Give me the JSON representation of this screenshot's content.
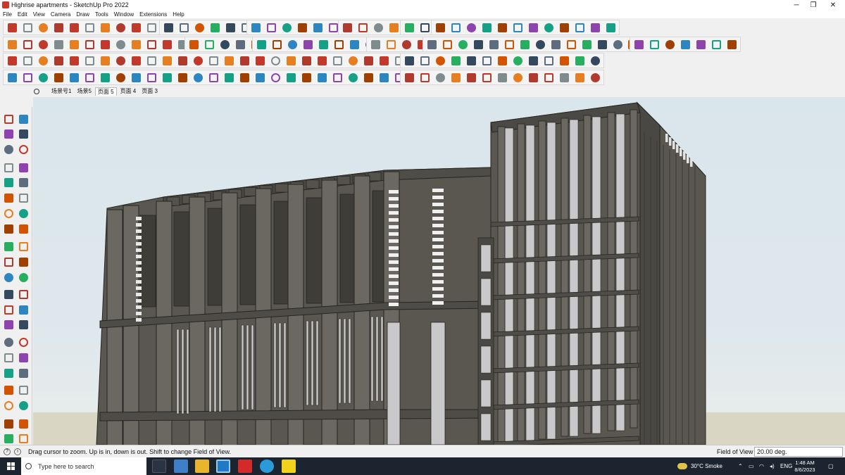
{
  "window": {
    "title": "Highrise apartments - SketchUp Pro 2022",
    "controls": {
      "minimize": "─",
      "restore": "❐",
      "close": "✕"
    }
  },
  "menu": [
    "File",
    "Edit",
    "View",
    "Camera",
    "Draw",
    "Tools",
    "Window",
    "Extensions",
    "Help"
  ],
  "scenes": {
    "tabs": [
      "场景号1",
      "场景5",
      "页面 5",
      "页面 4",
      "页面 3"
    ],
    "active_index": 2
  },
  "status": {
    "message": "Drag cursor to zoom.  Up is in, down is out. Shift to change Field of View.",
    "vcb_label": "Field of View",
    "vcb_value": "20.00 deg."
  },
  "taskbar": {
    "search_placeholder": "Type here to search",
    "weather": "30°C  Smoke",
    "language": "ENG",
    "time": "1:48 AM",
    "date": "8/6/2023"
  },
  "colors": {
    "toolbar_bg": "#f0f0f0",
    "building_facade": "#5a5751",
    "building_fin": "#6b6862",
    "glass": "#c9c9c9",
    "sky": "#dbe7ec",
    "ground": "#d9d6c4",
    "taskbar": "#1c2430"
  }
}
